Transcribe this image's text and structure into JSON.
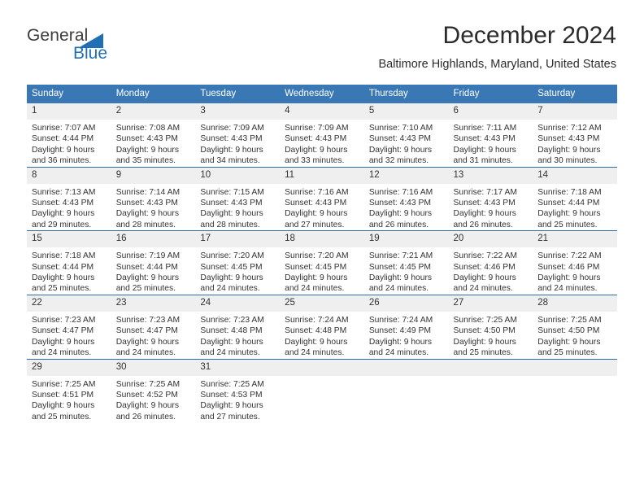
{
  "brand": {
    "name_part1": "General",
    "name_part2": "Blue",
    "accent_color": "#1f6fb5"
  },
  "header": {
    "title": "December 2024",
    "subtitle": "Baltimore Highlands, Maryland, United States"
  },
  "theme": {
    "header_row_bg": "#3a78b5",
    "row_divider": "#2f6ca8",
    "daynum_bg": "#efefef",
    "text": "#333333"
  },
  "weekdays": [
    "Sunday",
    "Monday",
    "Tuesday",
    "Wednesday",
    "Thursday",
    "Friday",
    "Saturday"
  ],
  "weeks": [
    [
      {
        "day": "1",
        "sunrise": "Sunrise: 7:07 AM",
        "sunset": "Sunset: 4:44 PM",
        "daylight1": "Daylight: 9 hours",
        "daylight2": "and 36 minutes."
      },
      {
        "day": "2",
        "sunrise": "Sunrise: 7:08 AM",
        "sunset": "Sunset: 4:43 PM",
        "daylight1": "Daylight: 9 hours",
        "daylight2": "and 35 minutes."
      },
      {
        "day": "3",
        "sunrise": "Sunrise: 7:09 AM",
        "sunset": "Sunset: 4:43 PM",
        "daylight1": "Daylight: 9 hours",
        "daylight2": "and 34 minutes."
      },
      {
        "day": "4",
        "sunrise": "Sunrise: 7:09 AM",
        "sunset": "Sunset: 4:43 PM",
        "daylight1": "Daylight: 9 hours",
        "daylight2": "and 33 minutes."
      },
      {
        "day": "5",
        "sunrise": "Sunrise: 7:10 AM",
        "sunset": "Sunset: 4:43 PM",
        "daylight1": "Daylight: 9 hours",
        "daylight2": "and 32 minutes."
      },
      {
        "day": "6",
        "sunrise": "Sunrise: 7:11 AM",
        "sunset": "Sunset: 4:43 PM",
        "daylight1": "Daylight: 9 hours",
        "daylight2": "and 31 minutes."
      },
      {
        "day": "7",
        "sunrise": "Sunrise: 7:12 AM",
        "sunset": "Sunset: 4:43 PM",
        "daylight1": "Daylight: 9 hours",
        "daylight2": "and 30 minutes."
      }
    ],
    [
      {
        "day": "8",
        "sunrise": "Sunrise: 7:13 AM",
        "sunset": "Sunset: 4:43 PM",
        "daylight1": "Daylight: 9 hours",
        "daylight2": "and 29 minutes."
      },
      {
        "day": "9",
        "sunrise": "Sunrise: 7:14 AM",
        "sunset": "Sunset: 4:43 PM",
        "daylight1": "Daylight: 9 hours",
        "daylight2": "and 28 minutes."
      },
      {
        "day": "10",
        "sunrise": "Sunrise: 7:15 AM",
        "sunset": "Sunset: 4:43 PM",
        "daylight1": "Daylight: 9 hours",
        "daylight2": "and 28 minutes."
      },
      {
        "day": "11",
        "sunrise": "Sunrise: 7:16 AM",
        "sunset": "Sunset: 4:43 PM",
        "daylight1": "Daylight: 9 hours",
        "daylight2": "and 27 minutes."
      },
      {
        "day": "12",
        "sunrise": "Sunrise: 7:16 AM",
        "sunset": "Sunset: 4:43 PM",
        "daylight1": "Daylight: 9 hours",
        "daylight2": "and 26 minutes."
      },
      {
        "day": "13",
        "sunrise": "Sunrise: 7:17 AM",
        "sunset": "Sunset: 4:43 PM",
        "daylight1": "Daylight: 9 hours",
        "daylight2": "and 26 minutes."
      },
      {
        "day": "14",
        "sunrise": "Sunrise: 7:18 AM",
        "sunset": "Sunset: 4:44 PM",
        "daylight1": "Daylight: 9 hours",
        "daylight2": "and 25 minutes."
      }
    ],
    [
      {
        "day": "15",
        "sunrise": "Sunrise: 7:18 AM",
        "sunset": "Sunset: 4:44 PM",
        "daylight1": "Daylight: 9 hours",
        "daylight2": "and 25 minutes."
      },
      {
        "day": "16",
        "sunrise": "Sunrise: 7:19 AM",
        "sunset": "Sunset: 4:44 PM",
        "daylight1": "Daylight: 9 hours",
        "daylight2": "and 25 minutes."
      },
      {
        "day": "17",
        "sunrise": "Sunrise: 7:20 AM",
        "sunset": "Sunset: 4:45 PM",
        "daylight1": "Daylight: 9 hours",
        "daylight2": "and 24 minutes."
      },
      {
        "day": "18",
        "sunrise": "Sunrise: 7:20 AM",
        "sunset": "Sunset: 4:45 PM",
        "daylight1": "Daylight: 9 hours",
        "daylight2": "and 24 minutes."
      },
      {
        "day": "19",
        "sunrise": "Sunrise: 7:21 AM",
        "sunset": "Sunset: 4:45 PM",
        "daylight1": "Daylight: 9 hours",
        "daylight2": "and 24 minutes."
      },
      {
        "day": "20",
        "sunrise": "Sunrise: 7:22 AM",
        "sunset": "Sunset: 4:46 PM",
        "daylight1": "Daylight: 9 hours",
        "daylight2": "and 24 minutes."
      },
      {
        "day": "21",
        "sunrise": "Sunrise: 7:22 AM",
        "sunset": "Sunset: 4:46 PM",
        "daylight1": "Daylight: 9 hours",
        "daylight2": "and 24 minutes."
      }
    ],
    [
      {
        "day": "22",
        "sunrise": "Sunrise: 7:23 AM",
        "sunset": "Sunset: 4:47 PM",
        "daylight1": "Daylight: 9 hours",
        "daylight2": "and 24 minutes."
      },
      {
        "day": "23",
        "sunrise": "Sunrise: 7:23 AM",
        "sunset": "Sunset: 4:47 PM",
        "daylight1": "Daylight: 9 hours",
        "daylight2": "and 24 minutes."
      },
      {
        "day": "24",
        "sunrise": "Sunrise: 7:23 AM",
        "sunset": "Sunset: 4:48 PM",
        "daylight1": "Daylight: 9 hours",
        "daylight2": "and 24 minutes."
      },
      {
        "day": "25",
        "sunrise": "Sunrise: 7:24 AM",
        "sunset": "Sunset: 4:48 PM",
        "daylight1": "Daylight: 9 hours",
        "daylight2": "and 24 minutes."
      },
      {
        "day": "26",
        "sunrise": "Sunrise: 7:24 AM",
        "sunset": "Sunset: 4:49 PM",
        "daylight1": "Daylight: 9 hours",
        "daylight2": "and 24 minutes."
      },
      {
        "day": "27",
        "sunrise": "Sunrise: 7:25 AM",
        "sunset": "Sunset: 4:50 PM",
        "daylight1": "Daylight: 9 hours",
        "daylight2": "and 25 minutes."
      },
      {
        "day": "28",
        "sunrise": "Sunrise: 7:25 AM",
        "sunset": "Sunset: 4:50 PM",
        "daylight1": "Daylight: 9 hours",
        "daylight2": "and 25 minutes."
      }
    ],
    [
      {
        "day": "29",
        "sunrise": "Sunrise: 7:25 AM",
        "sunset": "Sunset: 4:51 PM",
        "daylight1": "Daylight: 9 hours",
        "daylight2": "and 25 minutes."
      },
      {
        "day": "30",
        "sunrise": "Sunrise: 7:25 AM",
        "sunset": "Sunset: 4:52 PM",
        "daylight1": "Daylight: 9 hours",
        "daylight2": "and 26 minutes."
      },
      {
        "day": "31",
        "sunrise": "Sunrise: 7:25 AM",
        "sunset": "Sunset: 4:53 PM",
        "daylight1": "Daylight: 9 hours",
        "daylight2": "and 27 minutes."
      },
      {
        "day": "",
        "sunrise": "",
        "sunset": "",
        "daylight1": "",
        "daylight2": ""
      },
      {
        "day": "",
        "sunrise": "",
        "sunset": "",
        "daylight1": "",
        "daylight2": ""
      },
      {
        "day": "",
        "sunrise": "",
        "sunset": "",
        "daylight1": "",
        "daylight2": ""
      },
      {
        "day": "",
        "sunrise": "",
        "sunset": "",
        "daylight1": "",
        "daylight2": ""
      }
    ]
  ]
}
